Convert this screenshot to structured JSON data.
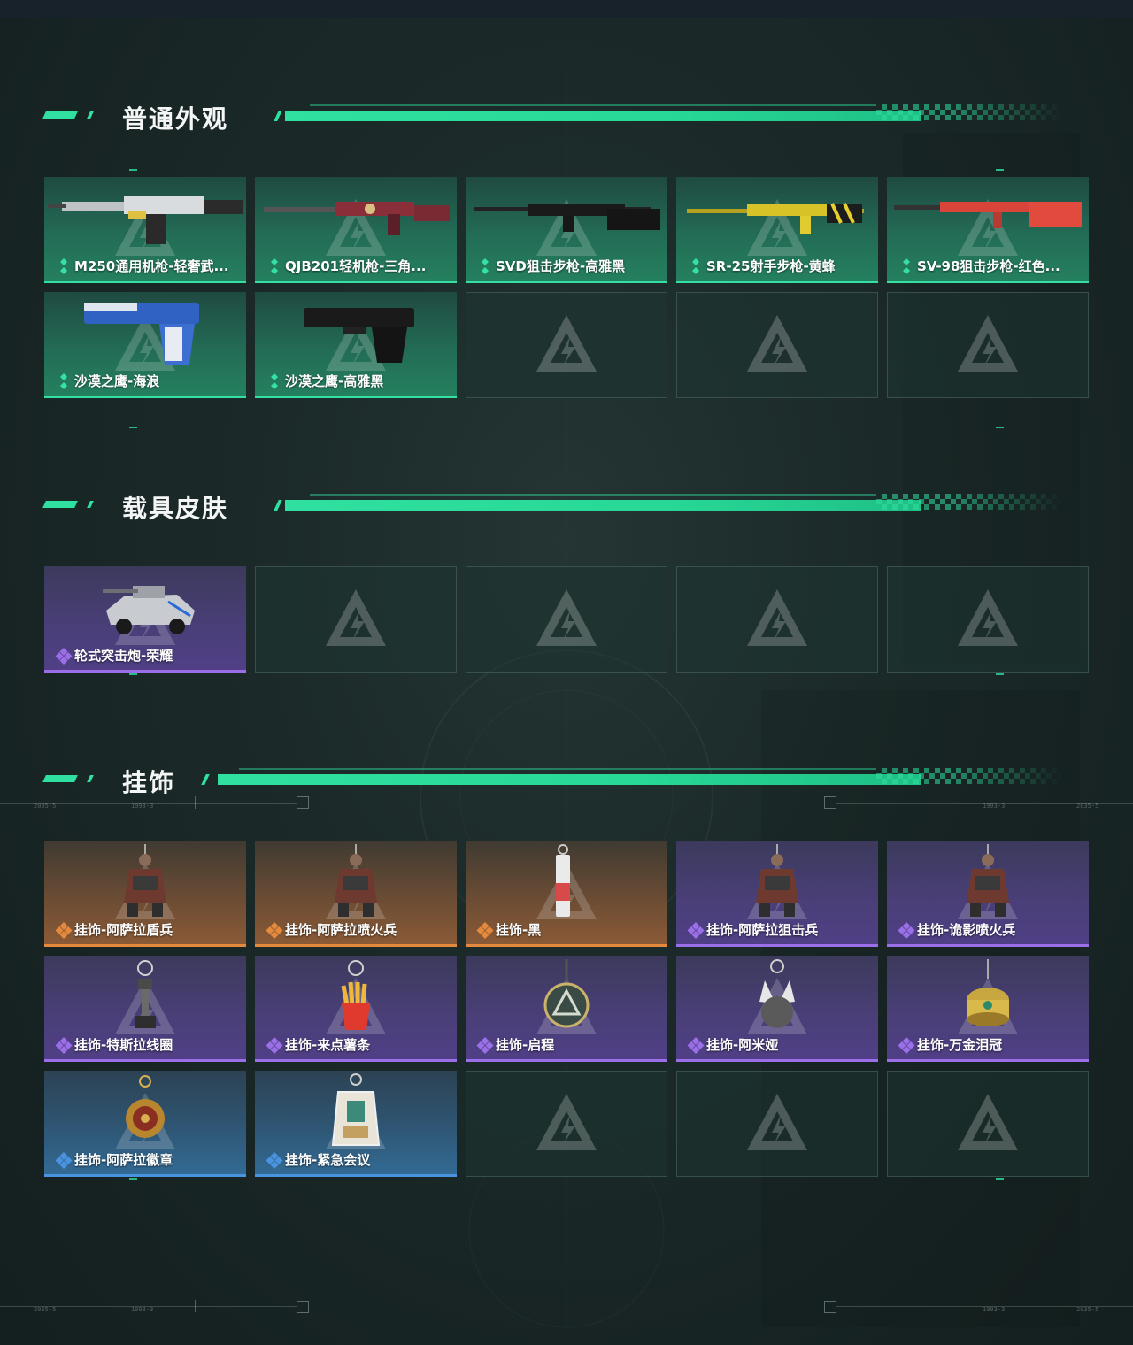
{
  "sections": [
    {
      "title": "普通外观",
      "items": [
        {
          "label": "M250通用机枪-轻奢武...",
          "rarity": "green",
          "kind": "lmg"
        },
        {
          "label": "QJB201轻机枪-三角...",
          "rarity": "green",
          "kind": "rifle"
        },
        {
          "label": "SVD狙击步枪-高雅黑",
          "rarity": "green",
          "kind": "sniper"
        },
        {
          "label": "SR-25射手步枪-黄蜂",
          "rarity": "green",
          "kind": "marksman"
        },
        {
          "label": "SV-98狙击步枪-红色...",
          "rarity": "green",
          "kind": "bolt"
        },
        {
          "label": "沙漠之鹰-海浪",
          "rarity": "green",
          "kind": "pistol-blue"
        },
        {
          "label": "沙漠之鹰-高雅黑",
          "rarity": "green",
          "kind": "pistol-black"
        },
        {
          "label": "",
          "rarity": "empty"
        },
        {
          "label": "",
          "rarity": "empty"
        },
        {
          "label": "",
          "rarity": "empty"
        }
      ]
    },
    {
      "title": "载具皮肤",
      "items": [
        {
          "label": "轮式突击炮-荣耀",
          "rarity": "purple",
          "kind": "vehicle"
        },
        {
          "label": "",
          "rarity": "empty"
        },
        {
          "label": "",
          "rarity": "empty"
        },
        {
          "label": "",
          "rarity": "empty"
        },
        {
          "label": "",
          "rarity": "empty"
        }
      ]
    },
    {
      "title": "挂饰",
      "items": [
        {
          "label": "挂饰-阿萨拉盾兵",
          "rarity": "orange",
          "kind": "figure"
        },
        {
          "label": "挂饰-阿萨拉喷火兵",
          "rarity": "orange",
          "kind": "figure"
        },
        {
          "label": "挂饰-黑",
          "rarity": "orange",
          "kind": "tag"
        },
        {
          "label": "挂饰-阿萨拉狙击兵",
          "rarity": "purple",
          "kind": "figure"
        },
        {
          "label": "挂饰-诡影喷火兵",
          "rarity": "purple",
          "kind": "figure"
        },
        {
          "label": "挂饰-特斯拉线圈",
          "rarity": "purple",
          "kind": "coil"
        },
        {
          "label": "挂饰-来点薯条",
          "rarity": "purple",
          "kind": "fries"
        },
        {
          "label": "挂饰-启程",
          "rarity": "purple",
          "kind": "medal"
        },
        {
          "label": "挂饰-阿米娅",
          "rarity": "purple",
          "kind": "plush"
        },
        {
          "label": "挂饰-万金泪冠",
          "rarity": "purple",
          "kind": "crown"
        },
        {
          "label": "挂饰-阿萨拉徽章",
          "rarity": "blue",
          "kind": "badge"
        },
        {
          "label": "挂饰-紧急会议",
          "rarity": "blue",
          "kind": "acrylic"
        },
        {
          "label": "",
          "rarity": "empty"
        },
        {
          "label": "",
          "rarity": "empty"
        },
        {
          "label": "",
          "rarity": "empty"
        }
      ]
    }
  ],
  "colors": {
    "accent": "#2fe0a0",
    "green": "#34e0a2",
    "purple": "#9a6fe8",
    "orange": "#e58a3c",
    "blue": "#4a93e0"
  },
  "decor_text": {
    "a": "2035-5",
    "b": "1993-3"
  }
}
